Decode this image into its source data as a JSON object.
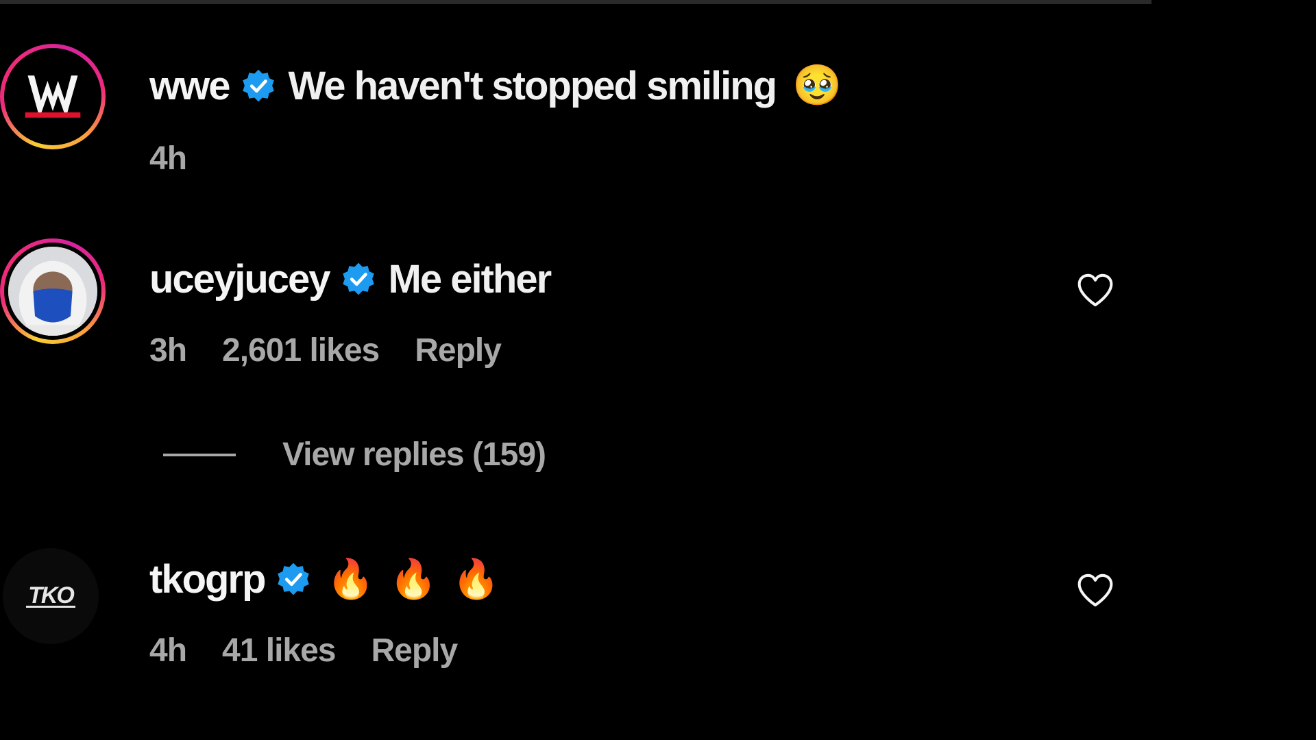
{
  "comments": [
    {
      "username": "wwe",
      "text": "We haven't stopped smiling",
      "emoji": "🥹",
      "time": "4h",
      "avatar_icon": "wwe-logo"
    },
    {
      "username": "uceyjucey",
      "text": "Me either",
      "time": "3h",
      "likes": "2,601 likes",
      "reply_label": "Reply",
      "view_replies": "View replies (159)",
      "avatar_icon": "person-avatar"
    },
    {
      "username": "tkogrp",
      "text": "",
      "emojis": [
        "🔥",
        "🔥",
        "🔥"
      ],
      "time": "4h",
      "likes": "41 likes",
      "reply_label": "Reply",
      "avatar_icon": "tko-logo"
    }
  ],
  "colors": {
    "background": "#000000",
    "verified": "#1d9bf0",
    "muted_text": "#a8a8a8",
    "primary_text": "#f5f5f5"
  }
}
